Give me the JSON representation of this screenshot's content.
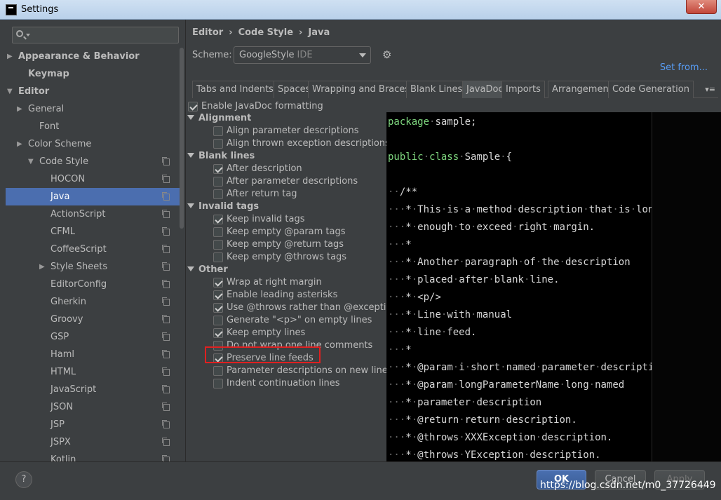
{
  "window": {
    "title": "Settings",
    "close_label": "✕"
  },
  "sidebar": {
    "search_placeholder": "",
    "items": [
      {
        "label": "Appearance & Behavior",
        "expanded": false,
        "bold": true
      },
      {
        "label": "Keymap",
        "bold": true
      },
      {
        "label": "Editor",
        "expanded": true,
        "bold": true
      },
      {
        "label": "General",
        "expanded": false
      },
      {
        "label": "Font"
      },
      {
        "label": "Color Scheme",
        "expanded": false
      },
      {
        "label": "Code Style",
        "expanded": true
      },
      {
        "label": "HOCON"
      },
      {
        "label": "Java",
        "selected": true
      },
      {
        "label": "ActionScript"
      },
      {
        "label": "CFML"
      },
      {
        "label": "CoffeeScript"
      },
      {
        "label": "Style Sheets",
        "expanded": false
      },
      {
        "label": "EditorConfig"
      },
      {
        "label": "Gherkin"
      },
      {
        "label": "Groovy"
      },
      {
        "label": "GSP"
      },
      {
        "label": "Haml"
      },
      {
        "label": "HTML"
      },
      {
        "label": "JavaScript"
      },
      {
        "label": "JSON"
      },
      {
        "label": "JSP"
      },
      {
        "label": "JSPX"
      },
      {
        "label": "Kotlin"
      }
    ]
  },
  "header": {
    "breadcrumb": [
      "Editor",
      "Code Style",
      "Java"
    ],
    "breadcrumb_sep": "›",
    "scheme_label": "Scheme:",
    "scheme_value": "GoogleStyle",
    "scheme_tag": "IDE",
    "set_from": "Set from..."
  },
  "tabs": [
    "Tabs and Indents",
    "Spaces",
    "Wrapping and Braces",
    "Blank Lines",
    "JavaDoc",
    "Imports",
    "Arrangement",
    "Code Generation"
  ],
  "active_tab": "JavaDoc",
  "tabs_more": "▾≡",
  "options": {
    "enable": {
      "label": "Enable JavaDoc formatting",
      "checked": true
    },
    "groups": [
      {
        "title": "Alignment",
        "items": [
          {
            "label": "Align parameter descriptions",
            "checked": false
          },
          {
            "label": "Align thrown exception descriptions",
            "checked": false
          }
        ]
      },
      {
        "title": "Blank lines",
        "items": [
          {
            "label": "After description",
            "checked": true
          },
          {
            "label": "After parameter descriptions",
            "checked": false
          },
          {
            "label": "After return tag",
            "checked": false
          }
        ]
      },
      {
        "title": "Invalid tags",
        "items": [
          {
            "label": "Keep invalid tags",
            "checked": true
          },
          {
            "label": "Keep empty @param tags",
            "checked": false
          },
          {
            "label": "Keep empty @return tags",
            "checked": false
          },
          {
            "label": "Keep empty @throws tags",
            "checked": false
          }
        ]
      },
      {
        "title": "Other",
        "items": [
          {
            "label": "Wrap at right margin",
            "checked": true
          },
          {
            "label": "Enable leading asterisks",
            "checked": true
          },
          {
            "label": "Use @throws rather than @exception",
            "checked": true
          },
          {
            "label": "Generate \"<p>\" on empty lines",
            "checked": false
          },
          {
            "label": "Keep empty lines",
            "checked": true
          },
          {
            "label": "Do not wrap one line comments",
            "checked": false
          },
          {
            "label": "Preserve line feeds",
            "checked": true,
            "highlighted": true
          },
          {
            "label": "Parameter descriptions on new line",
            "checked": false
          },
          {
            "label": "Indent continuation lines",
            "checked": false
          }
        ]
      }
    ]
  },
  "code_preview": [
    {
      "parts": [
        [
          "kw",
          "package"
        ],
        [
          "dim",
          "·"
        ],
        [
          "t",
          "sample;"
        ]
      ]
    },
    {
      "parts": []
    },
    {
      "parts": [
        [
          "kw",
          "public"
        ],
        [
          "dim",
          "·"
        ],
        [
          "kw",
          "class"
        ],
        [
          "dim",
          "·"
        ],
        [
          "t",
          "Sample"
        ],
        [
          "dim",
          "·"
        ],
        [
          "t",
          "{"
        ]
      ]
    },
    {
      "parts": []
    },
    {
      "parts": [
        [
          "dim",
          "··"
        ],
        [
          "t",
          "/**"
        ]
      ]
    },
    {
      "parts": [
        [
          "dim",
          "···"
        ],
        [
          "t",
          "*"
        ],
        [
          "dim",
          "·"
        ],
        [
          "t",
          "This"
        ],
        [
          "dim",
          "·"
        ],
        [
          "t",
          "is"
        ],
        [
          "dim",
          "·"
        ],
        [
          "t",
          "a"
        ],
        [
          "dim",
          "·"
        ],
        [
          "t",
          "method"
        ],
        [
          "dim",
          "·"
        ],
        [
          "t",
          "description"
        ],
        [
          "dim",
          "·"
        ],
        [
          "t",
          "that"
        ],
        [
          "dim",
          "·"
        ],
        [
          "t",
          "is"
        ],
        [
          "dim",
          "·"
        ],
        [
          "t",
          "long"
        ]
      ]
    },
    {
      "parts": [
        [
          "dim",
          "···"
        ],
        [
          "t",
          "*"
        ],
        [
          "dim",
          "·"
        ],
        [
          "t",
          "enough"
        ],
        [
          "dim",
          "·"
        ],
        [
          "t",
          "to"
        ],
        [
          "dim",
          "·"
        ],
        [
          "t",
          "exceed"
        ],
        [
          "dim",
          "·"
        ],
        [
          "t",
          "right"
        ],
        [
          "dim",
          "·"
        ],
        [
          "t",
          "margin."
        ]
      ]
    },
    {
      "parts": [
        [
          "dim",
          "···"
        ],
        [
          "t",
          "*"
        ]
      ]
    },
    {
      "parts": [
        [
          "dim",
          "···"
        ],
        [
          "t",
          "*"
        ],
        [
          "dim",
          "·"
        ],
        [
          "t",
          "Another"
        ],
        [
          "dim",
          "·"
        ],
        [
          "t",
          "paragraph"
        ],
        [
          "dim",
          "·"
        ],
        [
          "t",
          "of"
        ],
        [
          "dim",
          "·"
        ],
        [
          "t",
          "the"
        ],
        [
          "dim",
          "·"
        ],
        [
          "t",
          "description"
        ]
      ]
    },
    {
      "parts": [
        [
          "dim",
          "···"
        ],
        [
          "t",
          "*"
        ],
        [
          "dim",
          "·"
        ],
        [
          "t",
          "placed"
        ],
        [
          "dim",
          "·"
        ],
        [
          "t",
          "after"
        ],
        [
          "dim",
          "·"
        ],
        [
          "t",
          "blank"
        ],
        [
          "dim",
          "·"
        ],
        [
          "t",
          "line."
        ]
      ]
    },
    {
      "parts": [
        [
          "dim",
          "···"
        ],
        [
          "t",
          "*"
        ],
        [
          "dim",
          "·"
        ],
        [
          "t",
          "<p/>"
        ]
      ]
    },
    {
      "parts": [
        [
          "dim",
          "···"
        ],
        [
          "t",
          "*"
        ],
        [
          "dim",
          "·"
        ],
        [
          "t",
          "Line"
        ],
        [
          "dim",
          "·"
        ],
        [
          "t",
          "with"
        ],
        [
          "dim",
          "·"
        ],
        [
          "t",
          "manual"
        ]
      ]
    },
    {
      "parts": [
        [
          "dim",
          "···"
        ],
        [
          "t",
          "*"
        ],
        [
          "dim",
          "·"
        ],
        [
          "t",
          "line"
        ],
        [
          "dim",
          "·"
        ],
        [
          "t",
          "feed."
        ]
      ]
    },
    {
      "parts": [
        [
          "dim",
          "···"
        ],
        [
          "t",
          "*"
        ]
      ]
    },
    {
      "parts": [
        [
          "dim",
          "···"
        ],
        [
          "t",
          "*"
        ],
        [
          "dim",
          "·"
        ],
        [
          "t",
          "@param"
        ],
        [
          "dim",
          "·"
        ],
        [
          "t",
          "i"
        ],
        [
          "dim",
          "·"
        ],
        [
          "t",
          "short"
        ],
        [
          "dim",
          "·"
        ],
        [
          "t",
          "named"
        ],
        [
          "dim",
          "·"
        ],
        [
          "t",
          "parameter"
        ],
        [
          "dim",
          "·"
        ],
        [
          "t",
          "description"
        ]
      ]
    },
    {
      "parts": [
        [
          "dim",
          "···"
        ],
        [
          "t",
          "*"
        ],
        [
          "dim",
          "·"
        ],
        [
          "t",
          "@param"
        ],
        [
          "dim",
          "·"
        ],
        [
          "t",
          "longParameterName"
        ],
        [
          "dim",
          "·"
        ],
        [
          "t",
          "long"
        ],
        [
          "dim",
          "·"
        ],
        [
          "t",
          "named"
        ]
      ]
    },
    {
      "parts": [
        [
          "dim",
          "···"
        ],
        [
          "t",
          "*"
        ],
        [
          "dim",
          "·"
        ],
        [
          "t",
          "parameter"
        ],
        [
          "dim",
          "·"
        ],
        [
          "t",
          "description"
        ]
      ]
    },
    {
      "parts": [
        [
          "dim",
          "···"
        ],
        [
          "t",
          "*"
        ],
        [
          "dim",
          "·"
        ],
        [
          "t",
          "@return"
        ],
        [
          "dim",
          "·"
        ],
        [
          "t",
          "return"
        ],
        [
          "dim",
          "·"
        ],
        [
          "t",
          "description."
        ]
      ]
    },
    {
      "parts": [
        [
          "dim",
          "···"
        ],
        [
          "t",
          "*"
        ],
        [
          "dim",
          "·"
        ],
        [
          "t",
          "@throws"
        ],
        [
          "dim",
          "·"
        ],
        [
          "t",
          "XXXException"
        ],
        [
          "dim",
          "·"
        ],
        [
          "t",
          "description."
        ]
      ]
    },
    {
      "parts": [
        [
          "dim",
          "···"
        ],
        [
          "t",
          "*"
        ],
        [
          "dim",
          "·"
        ],
        [
          "t",
          "@throws"
        ],
        [
          "dim",
          "·"
        ],
        [
          "t",
          "YException"
        ],
        [
          "dim",
          "·"
        ],
        [
          "t",
          "description."
        ]
      ]
    }
  ],
  "footer": {
    "help_label": "?",
    "ok_label": "OK",
    "cancel_label": "Cancel",
    "apply_label": "Apply",
    "watermark": "https://blog.csdn.net/m0_37726449"
  },
  "colors": {
    "background": "#3c3f41",
    "selection": "#4b6eaf",
    "link": "#589df6",
    "keyword": "#7fd77f",
    "highlight_box": "#e02020"
  }
}
